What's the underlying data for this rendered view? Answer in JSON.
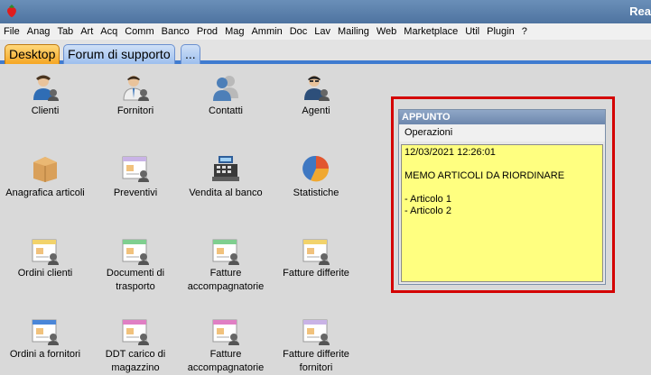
{
  "window": {
    "title": "Rea"
  },
  "menu": [
    "File",
    "Anag",
    "Tab",
    "Art",
    "Acq",
    "Comm",
    "Banco",
    "Prod",
    "Mag",
    "Ammin",
    "Doc",
    "Lav",
    "Mailing",
    "Web",
    "Marketplace",
    "Util",
    "Plugin",
    "?"
  ],
  "tabs": [
    "Desktop",
    "Forum di supporto",
    "..."
  ],
  "desktop": {
    "items": [
      {
        "label": "Clienti",
        "icon": "clients-icon"
      },
      {
        "label": "Fornitori",
        "icon": "suppliers-icon"
      },
      {
        "label": "Contatti",
        "icon": "contacts-icon"
      },
      {
        "label": "Agenti",
        "icon": "agents-icon"
      },
      {
        "label": "Anagrafica articoli",
        "icon": "package-icon"
      },
      {
        "label": "Preventivi",
        "icon": "quote-icon"
      },
      {
        "label": "Vendita al banco",
        "icon": "cash-register-icon"
      },
      {
        "label": "Statistiche",
        "icon": "pie-chart-icon"
      },
      {
        "label": "Ordini clienti",
        "icon": "customer-orders-icon"
      },
      {
        "label": "Documenti di trasporto",
        "icon": "transport-docs-icon"
      },
      {
        "label": "Fatture accompagnatorie",
        "icon": "invoice-icon"
      },
      {
        "label": "Fatture differite",
        "icon": "deferred-invoice-icon"
      },
      {
        "label": "Ordini a fornitori",
        "icon": "supplier-orders-icon"
      },
      {
        "label": "DDT carico di magazzino",
        "icon": "warehouse-ddt-icon"
      },
      {
        "label": "Fatture accompagnatorie",
        "icon": "invoice-icon"
      },
      {
        "label": "Fatture differite fornitori",
        "icon": "deferred-supplier-invoice-icon"
      }
    ]
  },
  "note": {
    "title": "APPUNTO",
    "menu_label": "Operazioni",
    "lines": [
      "12/03/2021 12:26:01",
      "",
      "MEMO ARTICOLI DA RIORDINARE",
      "",
      "- Articolo 1",
      "- Articolo 2"
    ]
  },
  "colors": {
    "highlight_frame": "#d40000",
    "memo_bg": "#ffff80",
    "active_tab": "#f5a623"
  }
}
